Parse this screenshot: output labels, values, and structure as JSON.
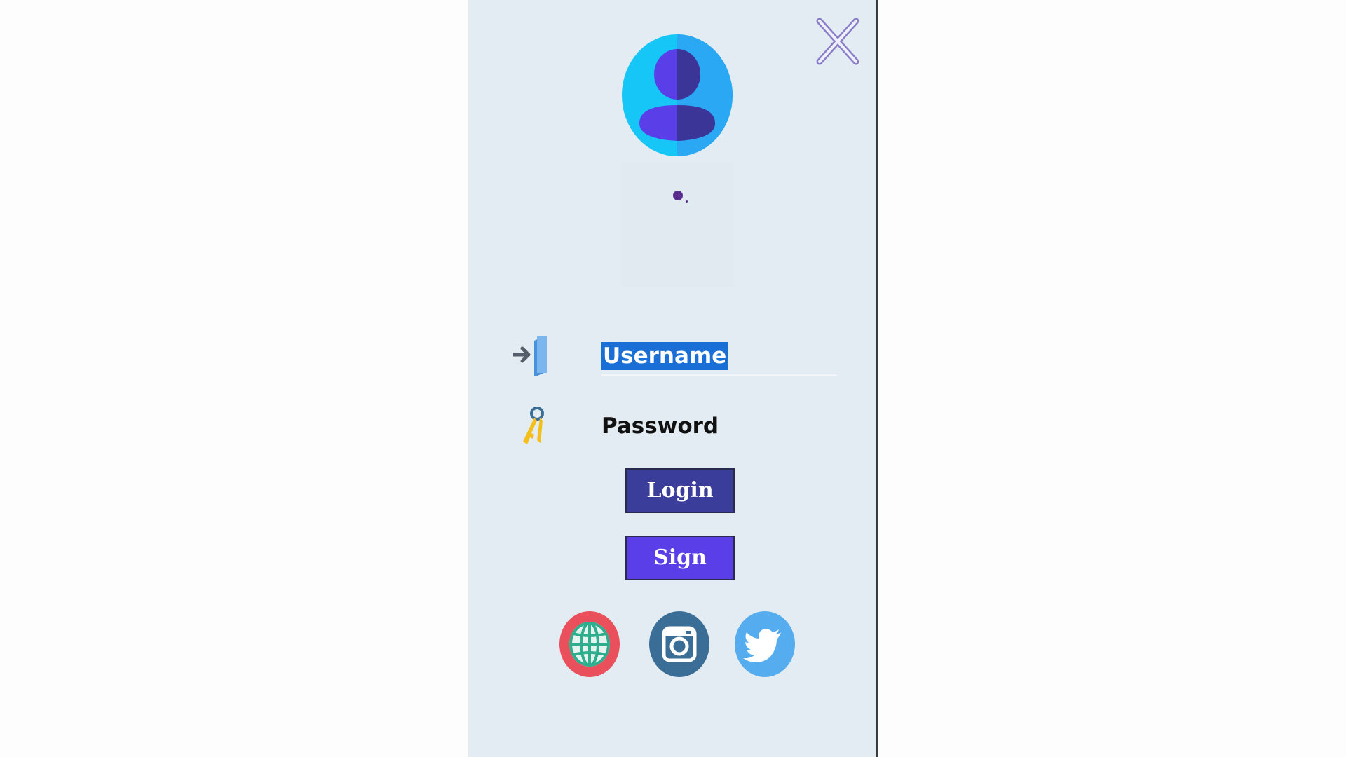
{
  "form": {
    "username_value": "Username",
    "password_placeholder": "Password"
  },
  "buttons": {
    "login_label": "Login",
    "sign_label": "Sign"
  },
  "icons": {
    "close": "close-icon",
    "avatar": "user-avatar-icon",
    "username": "login-arrow-icon",
    "password": "key-icon",
    "web": "globe-icon",
    "instagram": "instagram-icon",
    "twitter": "twitter-icon"
  },
  "colors": {
    "panel_bg": "#e3ecf2",
    "login_button": "#3a3d9a",
    "sign_button": "#5a3ee8",
    "selection_highlight": "#1a6fd6",
    "avatar_outer": "#1ec3f5",
    "avatar_figure": "#5a3ee8",
    "globe_ring": "#e9505c",
    "instagram_bg": "#3b6e96",
    "twitter_bg": "#55acee"
  }
}
